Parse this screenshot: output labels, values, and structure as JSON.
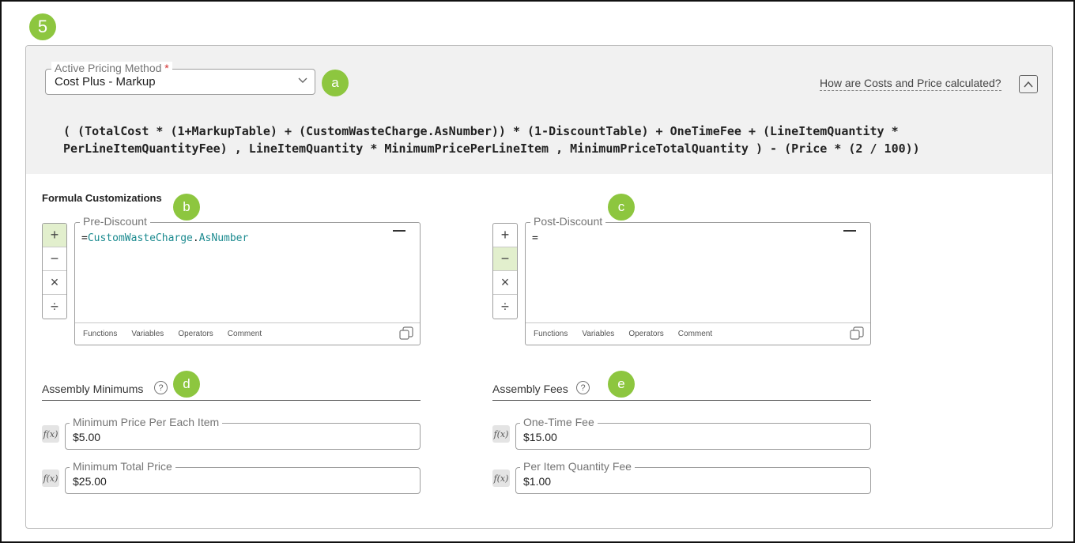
{
  "step_badge": "5",
  "pricing": {
    "label": "Active Pricing Method",
    "required_mark": "*",
    "value": "Cost Plus - Markup",
    "badge": "a",
    "help_link": "How are Costs and Price calculated?"
  },
  "formula_text": "( (TotalCost * (1+MarkupTable) + (CustomWasteCharge.AsNumber)) * (1-DiscountTable) + OneTimeFee + (LineItemQuantity *\nPerLineItemQuantityFee) , LineItemQuantity * MinimumPricePerLineItem , MinimumPriceTotalQuantity ) - (Price * (2 / 100))",
  "formula_customizations": {
    "title": "Formula Customizations",
    "operators": [
      "+",
      "−",
      "×",
      "÷"
    ],
    "footer_tabs": [
      "Functions",
      "Variables",
      "Operators",
      "Comment"
    ],
    "pre": {
      "label": "Pre-Discount",
      "badge": "b",
      "prefix": "=",
      "token_var": "CustomWasteCharge",
      "token_dot": ".",
      "token_prop": "AsNumber"
    },
    "post": {
      "label": "Post-Discount",
      "badge": "c",
      "prefix": "="
    }
  },
  "assembly_minimums": {
    "title": "Assembly Minimums",
    "help": "?",
    "badge": "d",
    "fields": [
      {
        "label": "Minimum Price Per Each Item",
        "value": "$5.00"
      },
      {
        "label": "Minimum Total Price",
        "value": "$25.00"
      }
    ]
  },
  "assembly_fees": {
    "title": "Assembly Fees",
    "help": "?",
    "badge": "e",
    "fields": [
      {
        "label": "One-Time Fee",
        "value": "$15.00"
      },
      {
        "label": "Per Item Quantity Fee",
        "value": "$1.00"
      }
    ]
  },
  "fx_icon_text": "f(x)",
  "colors": {
    "accent": "#8dc63f",
    "active_op": "#e2efcd",
    "token": "#1b8a8f"
  }
}
